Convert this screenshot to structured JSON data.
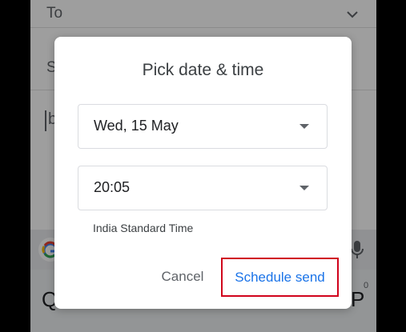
{
  "compose": {
    "to_label": "To",
    "subject_hint": "S",
    "body_hint": "b"
  },
  "keyboard": {
    "keys": [
      "Q",
      "P"
    ],
    "sup": "0"
  },
  "dialog": {
    "title": "Pick date & time",
    "date_value": "Wed, 15 May",
    "time_value": "20:05",
    "timezone": "India Standard Time",
    "cancel_label": "Cancel",
    "schedule_label": "Schedule send"
  },
  "colors": {
    "accent": "#1a73e8",
    "highlight_border": "#d0021b"
  }
}
